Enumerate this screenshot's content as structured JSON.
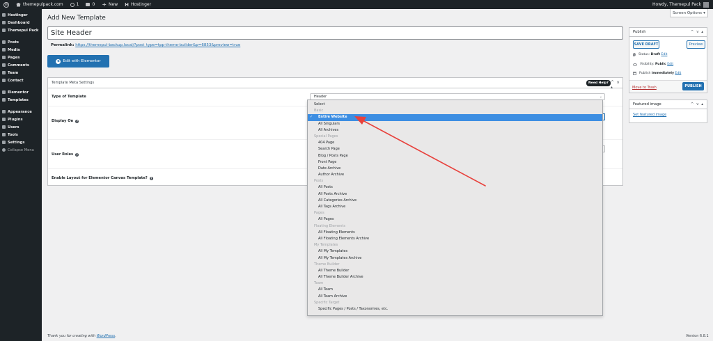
{
  "admin_bar": {
    "site": "themepulpack.com",
    "updates": "1",
    "comments": "0",
    "new_label": "New",
    "hostinger": "Hostinger",
    "howdy": "Howdy, Themepul Pack"
  },
  "sidebar": {
    "items": [
      {
        "label": "Hostinger",
        "icon": "hostinger-icon"
      },
      {
        "label": "Dashboard",
        "icon": "dashboard-icon"
      },
      {
        "label": "Themepul Pack",
        "icon": "themepul-icon"
      },
      {
        "label": "Posts",
        "icon": "pin-icon"
      },
      {
        "label": "Media",
        "icon": "media-icon"
      },
      {
        "label": "Pages",
        "icon": "pages-icon"
      },
      {
        "label": "Comments",
        "icon": "comments-icon"
      },
      {
        "label": "Team",
        "icon": "pin-icon"
      },
      {
        "label": "Contact",
        "icon": "contact-icon"
      },
      {
        "label": "Elementor",
        "icon": "elementor-icon"
      },
      {
        "label": "Templates",
        "icon": "templates-icon"
      },
      {
        "label": "Appearance",
        "icon": "brush-icon"
      },
      {
        "label": "Plugins",
        "icon": "plugin-icon"
      },
      {
        "label": "Users",
        "icon": "users-icon"
      },
      {
        "label": "Tools",
        "icon": "tools-icon"
      },
      {
        "label": "Settings",
        "icon": "settings-icon"
      },
      {
        "label": "Collapse Menu",
        "icon": "collapse-icon"
      }
    ]
  },
  "page": {
    "title": "Add New Template",
    "screen_options": "Screen Options",
    "post_title": "Site Header",
    "permalink_label": "Permalink:",
    "permalink_url": "https://themepul-backup.local/?post_type=tpp-theme-builder&p=6853&preview=true",
    "edit_elementor": "Edit with Elementor"
  },
  "metabox": {
    "title": "Template Meta Settings",
    "need_help": "Need Help?",
    "type_label": "Type of Template",
    "type_value": "Header",
    "display_on_label": "Display On",
    "user_roles_label": "User Roles",
    "canvas_label": "Enable Layout for Elementor Canvas Template?"
  },
  "publish": {
    "title": "Publish",
    "save_draft": "SAVE DRAFT",
    "preview": "Preview",
    "status_label": "Status:",
    "status_value": "Draft",
    "visibility_label": "Visibility:",
    "visibility_value": "Public",
    "publish_label": "Publish",
    "publish_value": "immediately",
    "edit": "Edit",
    "trash": "Move to Trash",
    "publish_btn": "PUBLISH"
  },
  "featured": {
    "title": "Featured image",
    "link": "Set featured image"
  },
  "footer": {
    "thanks_prefix": "Thank you for creating with",
    "wordpress": "WordPress",
    "version": "Version 6.8.1"
  },
  "dropdown": {
    "rows": [
      {
        "kind": "top",
        "label": "Select"
      },
      {
        "kind": "group",
        "label": "Basic"
      },
      {
        "kind": "option",
        "label": "Entire Website",
        "selected": true
      },
      {
        "kind": "option",
        "label": "All Singulars"
      },
      {
        "kind": "option",
        "label": "All Archives"
      },
      {
        "kind": "group",
        "label": "Special Pages"
      },
      {
        "kind": "option",
        "label": "404 Page"
      },
      {
        "kind": "option",
        "label": "Search Page"
      },
      {
        "kind": "option",
        "label": "Blog / Posts Page"
      },
      {
        "kind": "option",
        "label": "Front Page"
      },
      {
        "kind": "option",
        "label": "Date Archive"
      },
      {
        "kind": "option",
        "label": "Author Archive"
      },
      {
        "kind": "group",
        "label": "Posts"
      },
      {
        "kind": "option",
        "label": "All Posts"
      },
      {
        "kind": "option",
        "label": "All Posts Archive"
      },
      {
        "kind": "option",
        "label": "All Categories Archive"
      },
      {
        "kind": "option",
        "label": "All Tags Archive"
      },
      {
        "kind": "group",
        "label": "Pages"
      },
      {
        "kind": "option",
        "label": "All Pages"
      },
      {
        "kind": "group",
        "label": "Floating Elements"
      },
      {
        "kind": "option",
        "label": "All Floating Elements"
      },
      {
        "kind": "option",
        "label": "All Floating Elements Archive"
      },
      {
        "kind": "group",
        "label": "My Templates"
      },
      {
        "kind": "option",
        "label": "All My Templates"
      },
      {
        "kind": "option",
        "label": "All My Templates Archive"
      },
      {
        "kind": "group",
        "label": "Theme Builder"
      },
      {
        "kind": "option",
        "label": "All Theme Builder"
      },
      {
        "kind": "option",
        "label": "All Theme Builder Archive"
      },
      {
        "kind": "group",
        "label": "Team"
      },
      {
        "kind": "option",
        "label": "All Team"
      },
      {
        "kind": "option",
        "label": "All Team Archive"
      },
      {
        "kind": "group",
        "label": "Specific Target"
      },
      {
        "kind": "option",
        "label": "Specific Pages / Posts / Taxonomies, etc."
      }
    ]
  },
  "colors": {
    "admin_dark": "#1d2327",
    "primary_blue": "#2271b1",
    "selected_blue": "#3d8ee2",
    "annotation_red": "#e8413c"
  }
}
